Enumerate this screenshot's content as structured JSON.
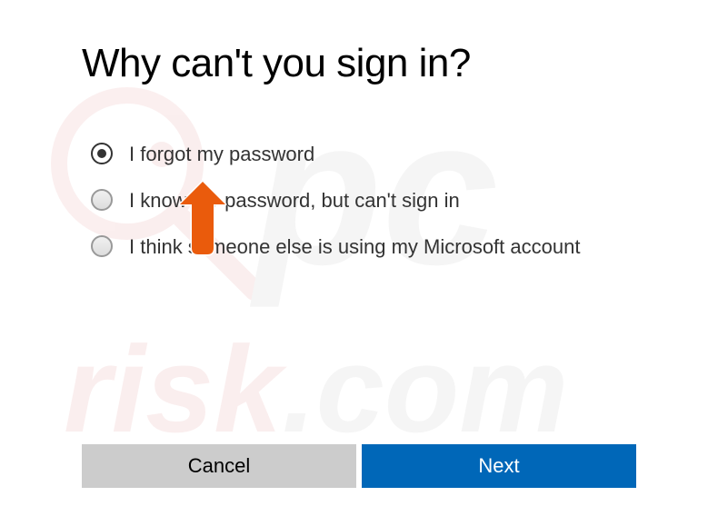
{
  "title": "Why can't you sign in?",
  "options": [
    {
      "label": "I forgot my password",
      "selected": true
    },
    {
      "label": "I know my password, but can't sign in",
      "selected": false
    },
    {
      "label": "I think someone else is using my Microsoft account",
      "selected": false
    }
  ],
  "buttons": {
    "cancel": "Cancel",
    "next": "Next"
  },
  "watermark": {
    "text_top": "pc",
    "text_bottom": "risk.com"
  },
  "cursor": {
    "color": "#ea5b0c",
    "target": "options.0"
  }
}
